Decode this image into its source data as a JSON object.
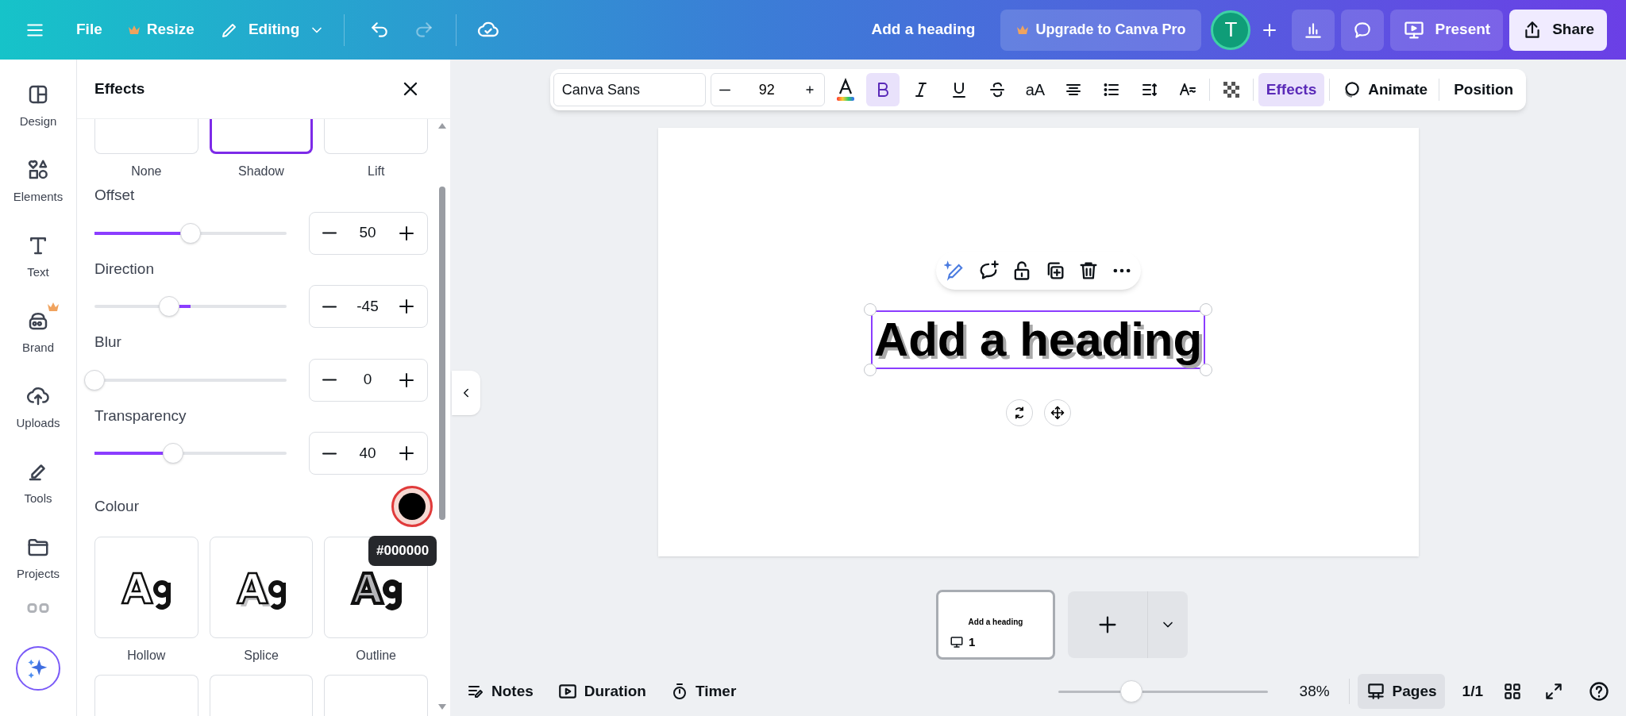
{
  "top_bar": {
    "file": "File",
    "resize": "Resize",
    "editing": "Editing",
    "doc_title": "Add a heading",
    "upgrade": "Upgrade to Canva Pro",
    "avatar": "T",
    "present": "Present",
    "share": "Share"
  },
  "sidebar": {
    "items": [
      {
        "label": "Design",
        "pro": false
      },
      {
        "label": "Elements",
        "pro": false
      },
      {
        "label": "Text",
        "pro": false
      },
      {
        "label": "Brand",
        "pro": true
      },
      {
        "label": "Uploads",
        "pro": false
      },
      {
        "label": "Tools",
        "pro": false
      },
      {
        "label": "Projects",
        "pro": false
      }
    ]
  },
  "effects_panel": {
    "title": "Effects",
    "top_styles": [
      {
        "label": "None",
        "selected": false
      },
      {
        "label": "Shadow",
        "selected": true
      },
      {
        "label": "Lift",
        "selected": false
      }
    ],
    "sliders": [
      {
        "label": "Offset",
        "level": 0.5,
        "value": "50",
        "kind": "fill"
      },
      {
        "label": "Direction",
        "level": 0.39,
        "value": "-45",
        "kind": "center"
      },
      {
        "label": "Blur",
        "level": 0,
        "value": "0",
        "kind": "fill"
      },
      {
        "label": "Transparency",
        "level": 0.41,
        "value": "40",
        "kind": "fill"
      }
    ],
    "colour": {
      "label": "Colour",
      "color": "#000000",
      "tooltip": "#000000"
    },
    "styles": [
      {
        "label": "Hollow",
        "kind": "hollow"
      },
      {
        "label": "Splice",
        "kind": "splice"
      },
      {
        "label": "Outline",
        "kind": "outline"
      }
    ]
  },
  "toolbar": {
    "font": "Canva Sans",
    "size": "92",
    "case": "aA",
    "bold_selected": true,
    "effects": "Effects",
    "effects_selected": true,
    "animate": "Animate",
    "position": "Position"
  },
  "canvas": {
    "heading": "Add a heading"
  },
  "pages": {
    "thumbnail_title": "Add a heading",
    "thumbnail_number": "1"
  },
  "bottom_bar": {
    "notes": "Notes",
    "duration": "Duration",
    "timer": "Timer",
    "zoom_slider": {
      "level": 0.35
    },
    "zoom": "38%",
    "pages": "Pages",
    "pages_selected": true,
    "page_count": "1/1"
  }
}
